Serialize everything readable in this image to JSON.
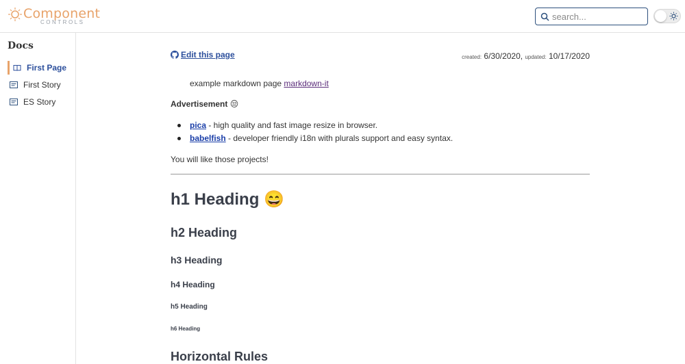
{
  "header": {
    "logo_text": "Component",
    "logo_subtext": "CONTROLS",
    "search_placeholder": "search..."
  },
  "sidebar": {
    "title": "Docs",
    "items": [
      {
        "label": "First Page",
        "icon": "book-icon",
        "active": true
      },
      {
        "label": "First Story",
        "icon": "story-icon",
        "active": false
      },
      {
        "label": "ES Story",
        "icon": "story-icon",
        "active": false
      }
    ]
  },
  "main": {
    "edit_link": "Edit this page",
    "created_label": "created:",
    "created_date": "6/30/2020,",
    "updated_label": "updated:",
    "updated_date": "10/17/2020",
    "example_text": "example markdown page ",
    "example_link": "markdown-it",
    "advertisement": "Advertisement 😒",
    "links": [
      {
        "name": "pica",
        "desc": " - high quality and fast image resize in browser."
      },
      {
        "name": "babelfish",
        "desc": " - developer friendly i18n with plurals support and easy syntax."
      }
    ],
    "like_text": "You will like those projects!",
    "h1": "h1 Heading 😄",
    "h2": "h2 Heading",
    "h3": "h3 Heading",
    "h4": "h4 Heading",
    "h5": "h5 Heading",
    "h6": "h6 Heading",
    "h_rules": "Horizontal Rules"
  },
  "colors": {
    "brand": "#e8a36a",
    "link": "#2c4f9c"
  }
}
